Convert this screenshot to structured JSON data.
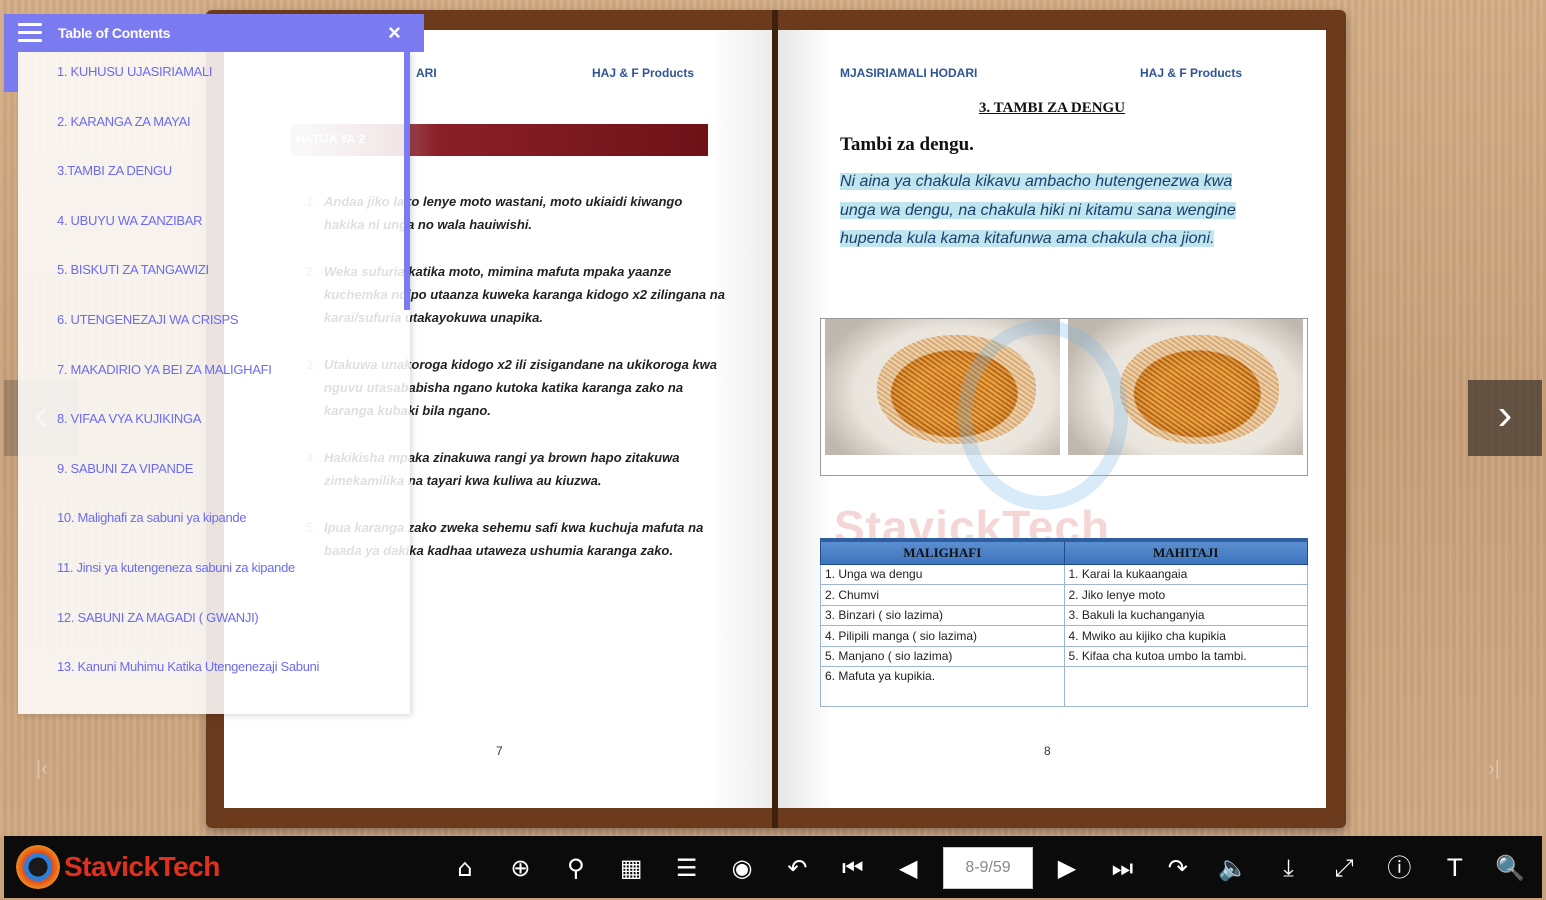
{
  "toc": {
    "title": "Table of Contents",
    "close_icon": "×",
    "items": [
      "1. KUHUSU UJASIRIAMALI",
      "2. KARANGA ZA MAYAI",
      "3.TAMBI ZA DENGU",
      "4. UBUYU WA ZANZIBAR",
      "5. BISKUTI ZA TANGAWIZI",
      "6. UTENGENEZAJI WA CRISPS",
      "7. MAKADIRIO YA BEI ZA MALIGHAFI",
      "8. VIFAA VYA KUJIKINGA",
      "9. SABUNI ZA VIPANDE",
      "10. Malighafi za sabuni ya kipande",
      "11. Jinsi ya kutengeneza sabuni za kipande",
      "12. SABUNI ZA MAGADI ( GWANJI)",
      "13. Kanuni Muhimu Katika Utengenezaji Sabuni"
    ]
  },
  "left_page": {
    "header_left": "ARI",
    "header_right": "HAJ & F Products",
    "banner": "HATUA YA 2",
    "steps": [
      {
        "n": "1.",
        "text": "Andaa jiko lako lenye moto wastani, moto ukiaidi kiwango hakika ni unga no wala hauiwishi."
      },
      {
        "n": "2.",
        "text": "Weka sufuria katika moto, mimina mafuta mpaka yaanze kuchemka ndipo utaanza kuweka karanga kidogo x2 zilingana na karai/sufuria utakayokuwa unapika."
      },
      {
        "n": "3.",
        "text": "Utakuwa unakoroga kidogo x2 ili zisigandane na ukikoroga kwa nguvu utasababisha ngano kutoka katika karanga zako na karanga kubaki bila ngano."
      },
      {
        "n": "4.",
        "text": "Hakikisha mpaka zinakuwa rangi ya brown hapo zitakuwa zimekamilika na tayari kwa kuliwa au kiuzwa."
      },
      {
        "n": "5.",
        "text": "Ipua karanga zako zweka sehemu safi kwa kuchuja mafuta na baada ya dakika kadhaa utaweza ushumia karanga zako."
      }
    ],
    "page_number": "7"
  },
  "right_page": {
    "header_left": "MJASIRIAMALI HODARI",
    "header_right": "HAJ & F Products",
    "section_title": "3. TAMBI ZA DENGU",
    "heading": "Tambi za dengu.",
    "paragraph": "Ni aina ya chakula kikavu ambacho hutengenezwa kwa unga wa dengu, na chakula hiki ni kitamu sana wengine hupenda kula kama kitafunwa ama chakula cha jioni.",
    "watermark": "StavickTech",
    "table": {
      "headers": [
        "MALIGHAFI",
        "MAHITAJI"
      ],
      "rows": [
        [
          "1. Unga wa dengu",
          "1. Karai la kukaangaia"
        ],
        [
          "2. Chumvi",
          "2. Jiko lenye moto"
        ],
        [
          "3. Binzari ( sio lazima)",
          "3. Bakuli la kuchanganyia"
        ],
        [
          "4. Pilipili manga ( sio lazima)",
          "4. Mwiko au kijiko cha kupikia"
        ],
        [
          "5. Manjano ( sio lazima)",
          "5. Kifaa cha kutoa umbo la tambi."
        ],
        [
          "6. Mafuta ya kupikia.",
          ""
        ]
      ]
    },
    "page_number": "8"
  },
  "nav": {
    "prev_icon": "‹",
    "next_icon": "›",
    "first_icon": "|‹",
    "last_icon": "›|"
  },
  "toolbar": {
    "brand": "StavickTech",
    "page_indicator": "8-9/59",
    "buttons_left": [
      {
        "name": "home-icon",
        "glyph": "⌂"
      },
      {
        "name": "zoom-in-icon",
        "glyph": "⊕"
      },
      {
        "name": "search-icon",
        "glyph": "⚲"
      },
      {
        "name": "thumbnails-icon",
        "glyph": "▦"
      },
      {
        "name": "toc-icon",
        "glyph": "☰"
      },
      {
        "name": "autoplay-icon",
        "glyph": "◉"
      },
      {
        "name": "undo-icon",
        "glyph": "↶"
      },
      {
        "name": "first-page-icon",
        "glyph": "⏮"
      },
      {
        "name": "prev-page-icon",
        "glyph": "◀"
      }
    ],
    "buttons_right": [
      {
        "name": "next-page-icon",
        "glyph": "▶"
      },
      {
        "name": "last-page-icon",
        "glyph": "⏭"
      },
      {
        "name": "redo-icon",
        "glyph": "↷"
      },
      {
        "name": "sound-icon",
        "glyph": "🔈"
      },
      {
        "name": "download-icon",
        "glyph": "⤓"
      },
      {
        "name": "fullscreen-icon",
        "glyph": "⤢"
      },
      {
        "name": "info-icon",
        "glyph": "ⓘ"
      },
      {
        "name": "text-icon",
        "glyph": "T"
      },
      {
        "name": "zoom-icon",
        "glyph": "🔍"
      }
    ]
  }
}
